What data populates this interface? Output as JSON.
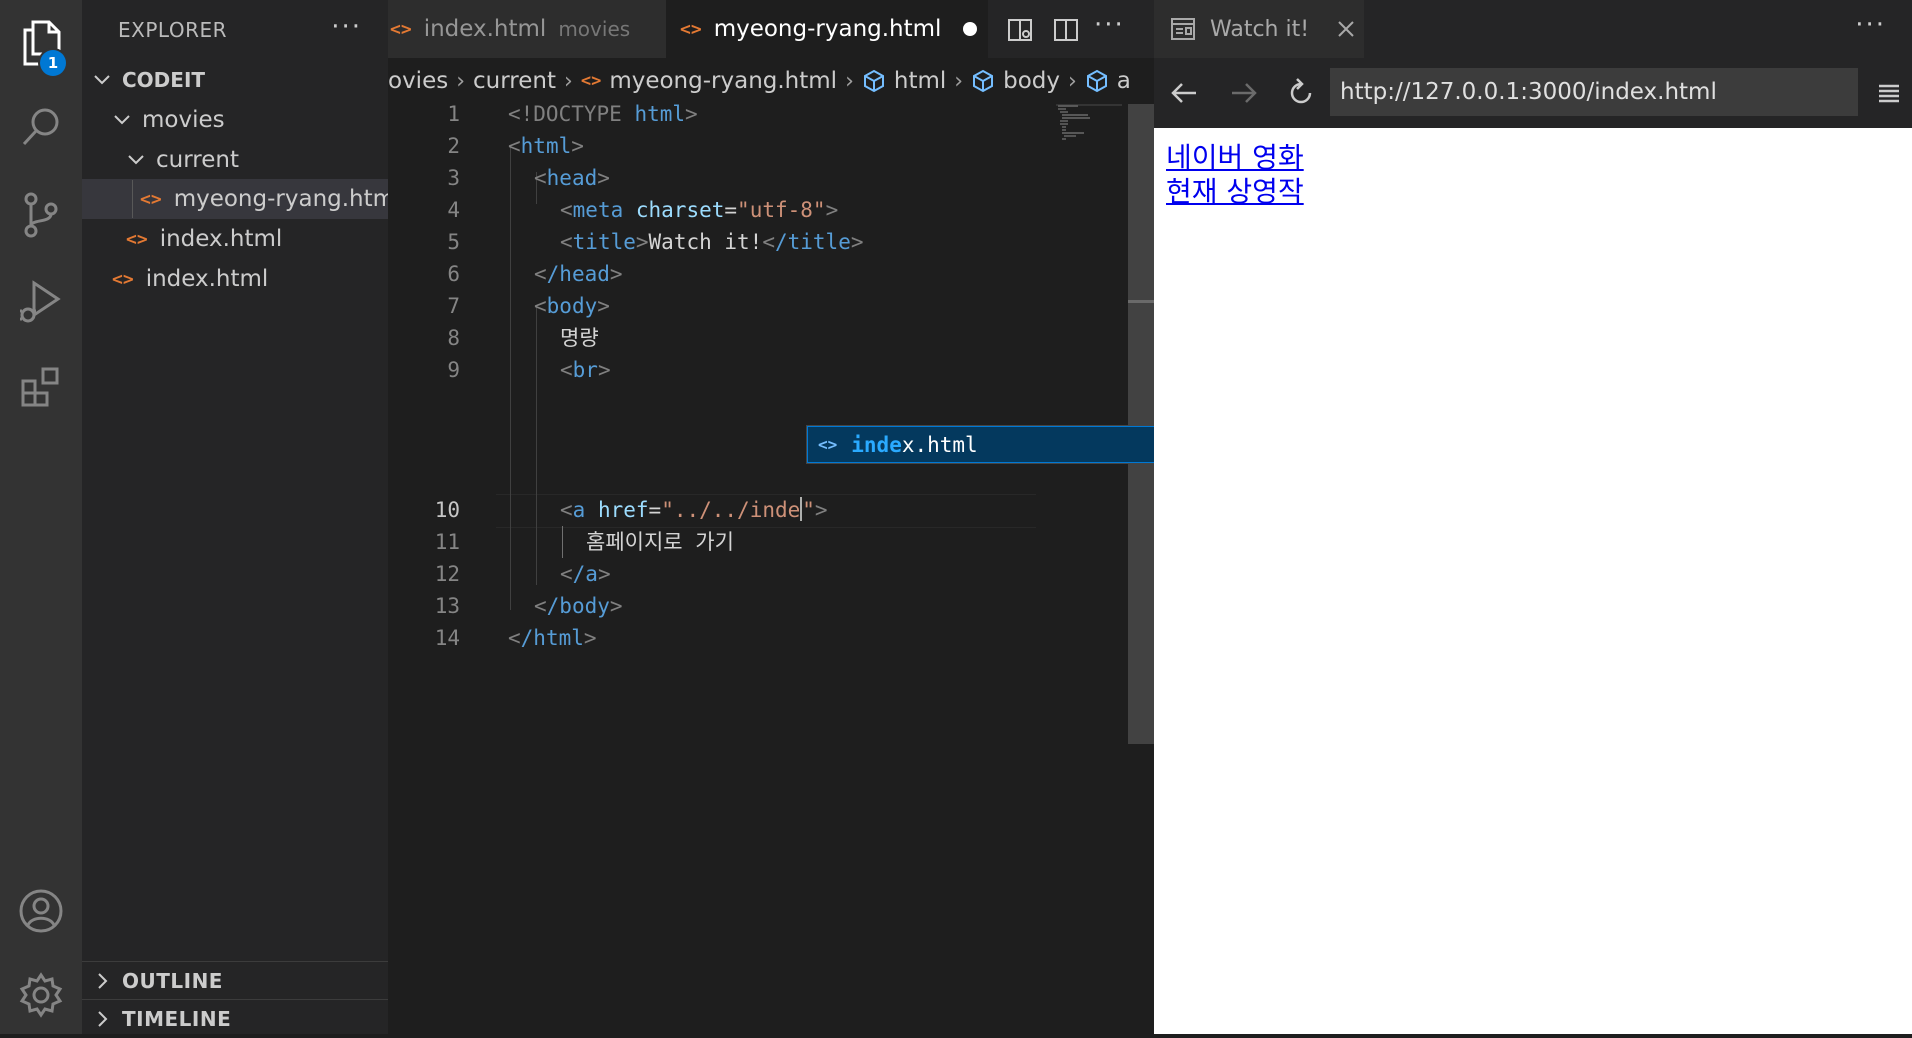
{
  "activity": {
    "explorer_badge": "1"
  },
  "sidebar": {
    "title": "EXPLORER",
    "more": "···",
    "tree": [
      {
        "label": "CODEIT",
        "kind": "root"
      },
      {
        "label": "movies",
        "kind": "folder"
      },
      {
        "label": "current",
        "kind": "folder"
      },
      {
        "label": "myeong-ryang.html",
        "kind": "file",
        "selected": true
      },
      {
        "label": "index.html",
        "kind": "file"
      },
      {
        "label": "index.html",
        "kind": "file"
      }
    ],
    "outline": "OUTLINE",
    "timeline": "TIMELINE"
  },
  "editor": {
    "tabs": [
      {
        "label": "index.html",
        "description": "movies",
        "active": false
      },
      {
        "label": "myeong-ryang.html",
        "dirty": true,
        "active": true
      }
    ],
    "more": "···",
    "breadcrumb": [
      "ovies",
      "current",
      "myeong-ryang.html",
      "html",
      "body",
      "a"
    ],
    "line_numbers": [
      "1",
      "2",
      "3",
      "4",
      "5",
      "6",
      "7",
      "8",
      "9",
      "10",
      "11",
      "12",
      "13",
      "14"
    ],
    "active_line": "10",
    "code": {
      "l1_doctype": "<!DOCTYPE",
      "l1_html": " html",
      "l1_close": ">",
      "l2_tag": "html",
      "l3_tag": "head",
      "l4_tag": "meta",
      "l4_attr": " charset",
      "l4_eq": "=",
      "l4_val": "\"utf-8\"",
      "l5_tag": "title",
      "l5_text": "Watch it!",
      "l5_close": "/title",
      "l6_tag": "/head",
      "l7_tag": "body",
      "l8_text": "명량",
      "l9_tag": "br",
      "l10_tag": "a",
      "l10_attr": " href",
      "l10_eq": "=",
      "l10_val_a": "\"../../inde",
      "l10_val_b": "\"",
      "l11_text": "홈페이지로 가기",
      "l12_tag": "/a",
      "l13_tag": "/body",
      "l14_tag": "/html"
    },
    "suggest": {
      "match": "inde",
      "rest": "x.html"
    }
  },
  "browser": {
    "tab_title": "Watch it!",
    "more": "···",
    "url": "http://127.0.0.1:3000/index.html",
    "links": [
      "네이버 영화",
      "현재 상영작"
    ]
  },
  "colors": {
    "accent": "#0078d4",
    "file_icon": "#e37933",
    "tag": "#569cd6",
    "attribute": "#9cdcfe",
    "string": "#ce9178",
    "link": "#0000ee"
  }
}
